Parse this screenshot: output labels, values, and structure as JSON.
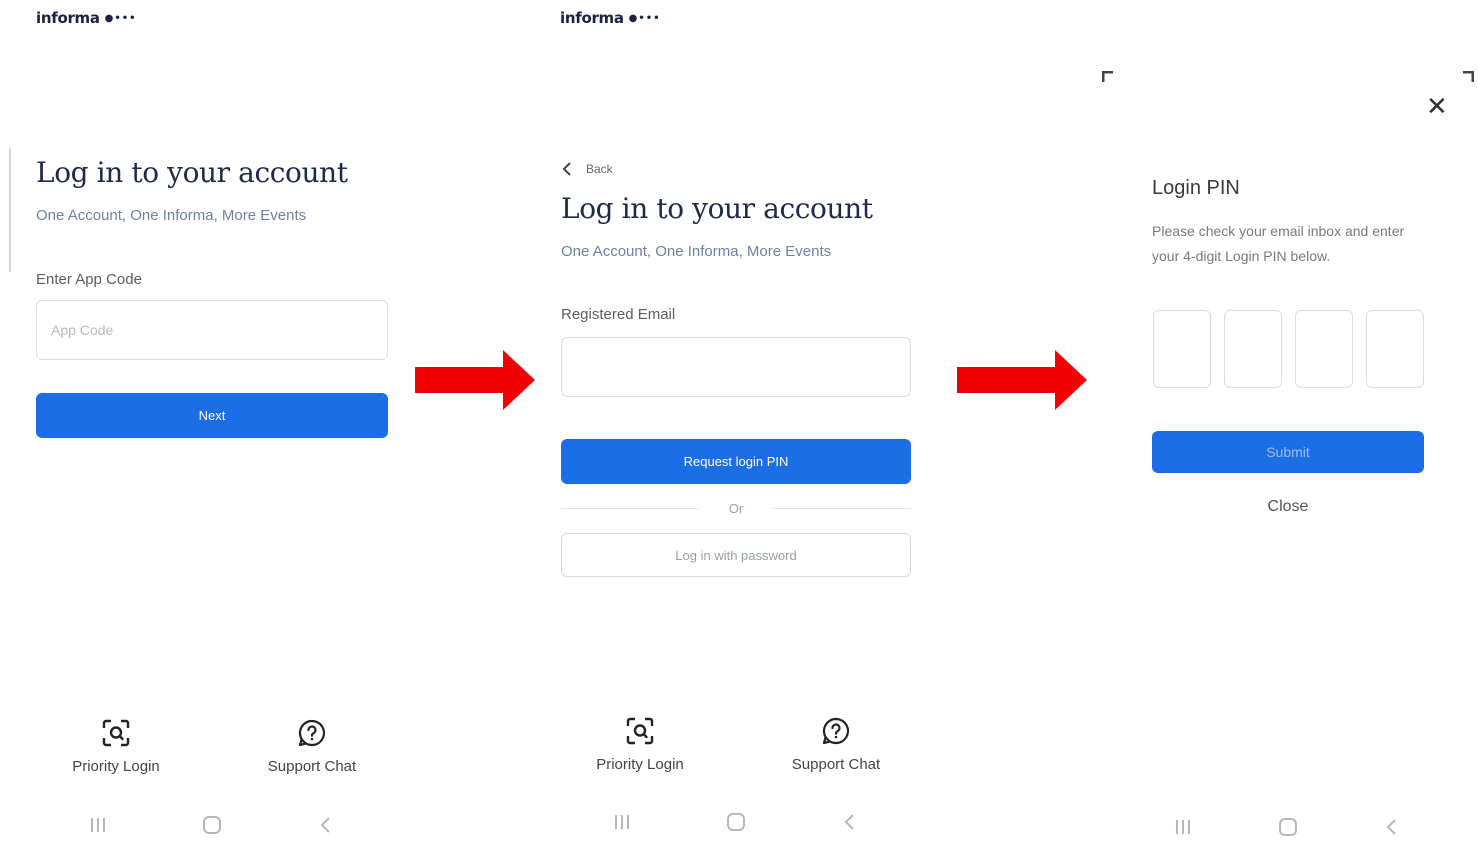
{
  "screen1": {
    "brand": "informa",
    "title": "Log in to your account",
    "subtitle": "One Account, One Informa, More Events",
    "field_label": "Enter App Code",
    "field_placeholder": "App Code",
    "next_label": "Next",
    "footer": {
      "priority_label": "Priority Login",
      "support_label": "Support Chat"
    }
  },
  "screen2": {
    "brand": "informa",
    "back_label": "Back",
    "title": "Log in to your account",
    "subtitle": "One Account, One Informa, More Events",
    "field_label": "Registered Email",
    "field_value": "",
    "request_pin_label": "Request login PIN",
    "or_label": "Or",
    "password_login_label": "Log in with password",
    "footer": {
      "priority_label": "Priority Login",
      "support_label": "Support Chat"
    }
  },
  "screen3": {
    "title": "Login PIN",
    "description": "Please check your email inbox and enter your 4-digit Login PIN below.",
    "pin_digits": [
      "",
      "",
      "",
      ""
    ],
    "submit_label": "Submit",
    "close_label": "Close"
  },
  "colors": {
    "primary": "#1b6ee5",
    "arrow": "#f00000",
    "title": "#1e2a4a",
    "subtitle": "#6f7fa6"
  },
  "icons": {
    "priority": "face-scan-icon",
    "support": "chat-question-icon",
    "nav_recent": "recent-apps-icon",
    "nav_home": "home-icon",
    "nav_back": "back-icon",
    "flow_arrow": "right-arrow-icon",
    "close": "close-icon",
    "back": "chevron-left-icon"
  }
}
